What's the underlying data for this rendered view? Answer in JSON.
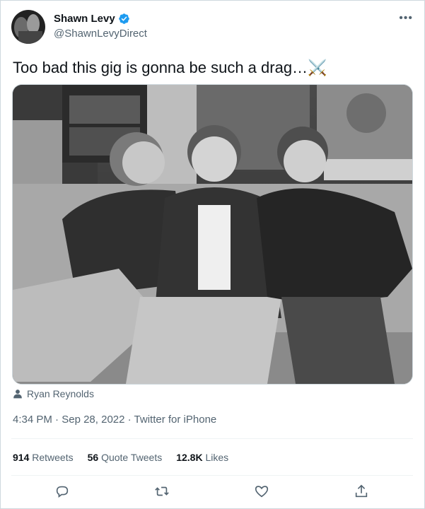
{
  "author": {
    "name": "Shawn Levy",
    "handle": "@ShawnLevyDirect",
    "verified_color": "#1d9bf0"
  },
  "menu_icon": "more-dots-icon",
  "tweet": {
    "text": "Too bad this gig is gonna be such a drag…⚔️"
  },
  "media": {
    "tagged_user": "Ryan Reynolds",
    "tag_icon": "person-icon"
  },
  "meta": {
    "time": "4:34 PM",
    "separator": "·",
    "date": "Sep 28, 2022",
    "source": "Twitter for iPhone"
  },
  "stats": {
    "retweets_count": "914",
    "retweets_label": "Retweets",
    "quotes_count": "56",
    "quotes_label": "Quote Tweets",
    "likes_count": "12.8K",
    "likes_label": "Likes"
  },
  "actions": [
    {
      "name": "reply",
      "icon": "reply-icon"
    },
    {
      "name": "retweet",
      "icon": "retweet-icon"
    },
    {
      "name": "like",
      "icon": "heart-icon"
    },
    {
      "name": "share",
      "icon": "share-icon"
    }
  ],
  "colors": {
    "text": "#0f1419",
    "secondary": "#536471",
    "border": "#cfd9de"
  }
}
